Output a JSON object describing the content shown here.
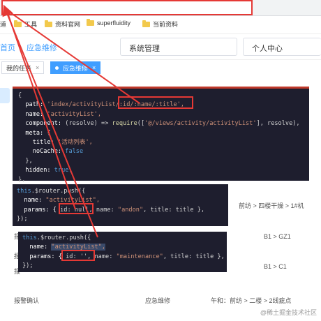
{
  "bookmarks": [
    "道",
    "工具",
    "资料官网",
    "superfluidity",
    "当前资料"
  ],
  "nav": {
    "home": "首页",
    "current": "应急维修"
  },
  "selects": {
    "system": "系统管理",
    "personal": "个人中心"
  },
  "tags": {
    "mine": "我的任务",
    "mine_close": "×",
    "active": "应急维修",
    "active_close": "×"
  },
  "rows": {
    "r1_right": "前纺 > 四楼干燥 > 1#机",
    "r2_right": "B1 > GZ1",
    "r3_right": "B1 > C1",
    "r4_left": "报警确认",
    "r4_mid": "应急维修",
    "r4_right": "午和：前纺 > 二楼 > 2线疵点",
    "partial_a": "报",
    "partial_b": "报",
    "partial_c": "报"
  },
  "code1": {
    "l1": "{",
    "l2_key": "path: ",
    "l2_val": "'index/activityList/:id/:name/:title',",
    "l3_key": "name: ",
    "l3_val": "'activityList',",
    "l4_key": "component: ",
    "l4_a": "(resolve) => ",
    "l4_fn": "require",
    "l4_b": "([",
    "l4_str": "'@/views/activity/activityList'",
    "l4_c": "], resolve),",
    "l5": "meta: {",
    "l6_key": "title: ",
    "l6_val": "'活动列表',",
    "l7_key": "noCache: ",
    "l7_val": "false",
    "l8": "},",
    "l9_key": "hidden: ",
    "l9_val": "true,",
    "l10": "},"
  },
  "code2": {
    "l1_kw": "this",
    "l1_rest": ".$router.push({",
    "l2_key": "name: ",
    "l2_val": "\"activityList\",",
    "l3_key": "params: { ",
    "l3_id": "id: null,",
    "l3_rest_a": " name: ",
    "l3_str_a": "\"andon\"",
    "l3_rest_b": ", title: title },",
    "l4": "});"
  },
  "code3": {
    "l1_kw": "this",
    "l1_rest": ".$router.push({",
    "l2_key": "name: ",
    "l2_val": "\"activityList\",",
    "l3_key": "params: { ",
    "l3_id": "id: '',",
    "l3_rest_a": " name: ",
    "l3_str_a": "\"maintenance\"",
    "l3_rest_b": ", title: title },",
    "l4": "});"
  },
  "watermark": "@稀土掘金技术社区",
  "colors": {
    "accent": "#409eff",
    "annotation": "#e53935",
    "code_bg": "#1e1e2e"
  }
}
